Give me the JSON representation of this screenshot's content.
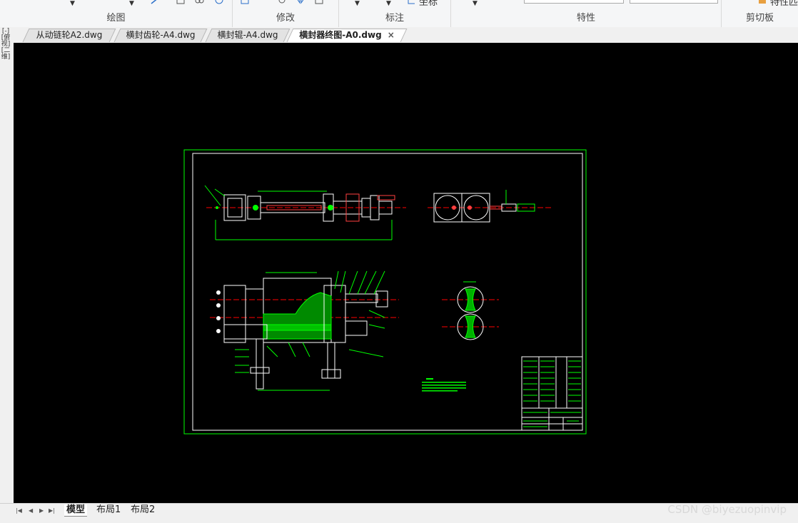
{
  "ribbon": {
    "groups": [
      {
        "id": "draw",
        "label": "绘图"
      },
      {
        "id": "modify",
        "label": "修改"
      },
      {
        "id": "annotate",
        "label": "标注"
      },
      {
        "id": "properties",
        "label": "特性"
      },
      {
        "id": "clipboard",
        "label": "剪切板"
      }
    ],
    "annotate_partial_text": "坐标",
    "clipboard_partial_text": "特性匹"
  },
  "tabs": [
    {
      "label": "从动链轮A2.dwg",
      "active": false
    },
    {
      "label": "横封齿轮-A4.dwg",
      "active": false
    },
    {
      "label": "横封辊-A4.dwg",
      "active": false
    },
    {
      "label": "横封器终图-A0.dwg",
      "active": true
    }
  ],
  "tab_close_glyph": "×",
  "left_toolbar": {
    "chars": [
      "[-]",
      "[俯",
      "视]",
      "[二",
      "维]"
    ]
  },
  "layout_tabs": [
    {
      "label": "模型",
      "active": true
    },
    {
      "label": "布局1",
      "active": false
    },
    {
      "label": "布局2",
      "active": false
    }
  ],
  "nav_buttons": [
    "|◀",
    "◀",
    "▶",
    "▶|"
  ],
  "watermark": "CSDN @biyezuopinvip",
  "colors": {
    "canvas": "#000000",
    "border": "#00ff00",
    "drawing": "#ffffff",
    "centerline": "#ff0000",
    "hatch": "#00c000"
  }
}
